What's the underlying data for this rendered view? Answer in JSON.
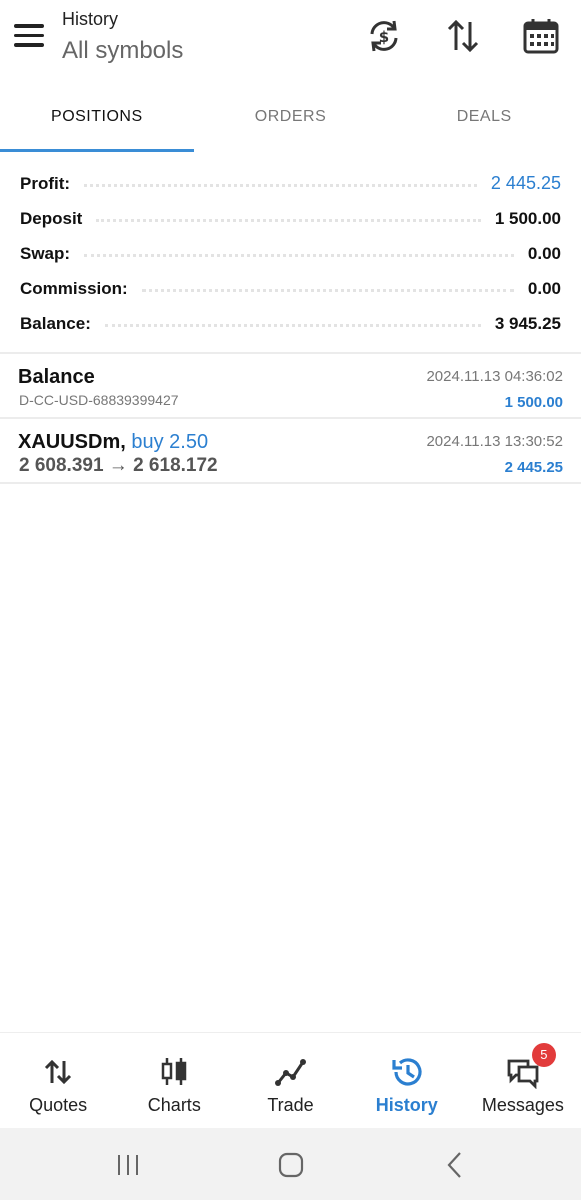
{
  "header": {
    "title": "History",
    "subtitle": "All symbols",
    "icons": [
      "menu-icon",
      "currency-exchange-icon",
      "sort-icon",
      "calendar-icon"
    ]
  },
  "tabs": [
    {
      "label": "POSITIONS",
      "active": true
    },
    {
      "label": "ORDERS",
      "active": false
    },
    {
      "label": "DEALS",
      "active": false
    }
  ],
  "summary": {
    "profit_label": "Profit:",
    "profit_value": "2 445.25",
    "deposit_label": "Deposit",
    "deposit_value": "1 500.00",
    "swap_label": "Swap:",
    "swap_value": "0.00",
    "commission_label": "Commission:",
    "commission_value": "0.00",
    "balance_label": "Balance:",
    "balance_value": "3 945.25"
  },
  "history": [
    {
      "title": "Balance",
      "sub": "D-CC-USD-68839399427",
      "time": "2024.11.13 04:36:02",
      "amount": "1 500.00"
    },
    {
      "symbol": "XAUUSDm,",
      "direction": "buy 2.50",
      "prices": "2 608.391 → 2 618.172",
      "time": "2024.11.13 13:30:52",
      "amount": "2 445.25"
    }
  ],
  "bottom_nav": [
    {
      "label": "Quotes",
      "icon": "quotes-icon"
    },
    {
      "label": "Charts",
      "icon": "charts-icon"
    },
    {
      "label": "Trade",
      "icon": "trade-icon"
    },
    {
      "label": "History",
      "icon": "history-icon",
      "active": true
    },
    {
      "label": "Messages",
      "icon": "messages-icon",
      "badge": "5"
    }
  ],
  "colors": {
    "accent": "#2b7fd0",
    "badge": "#e23b3b"
  }
}
